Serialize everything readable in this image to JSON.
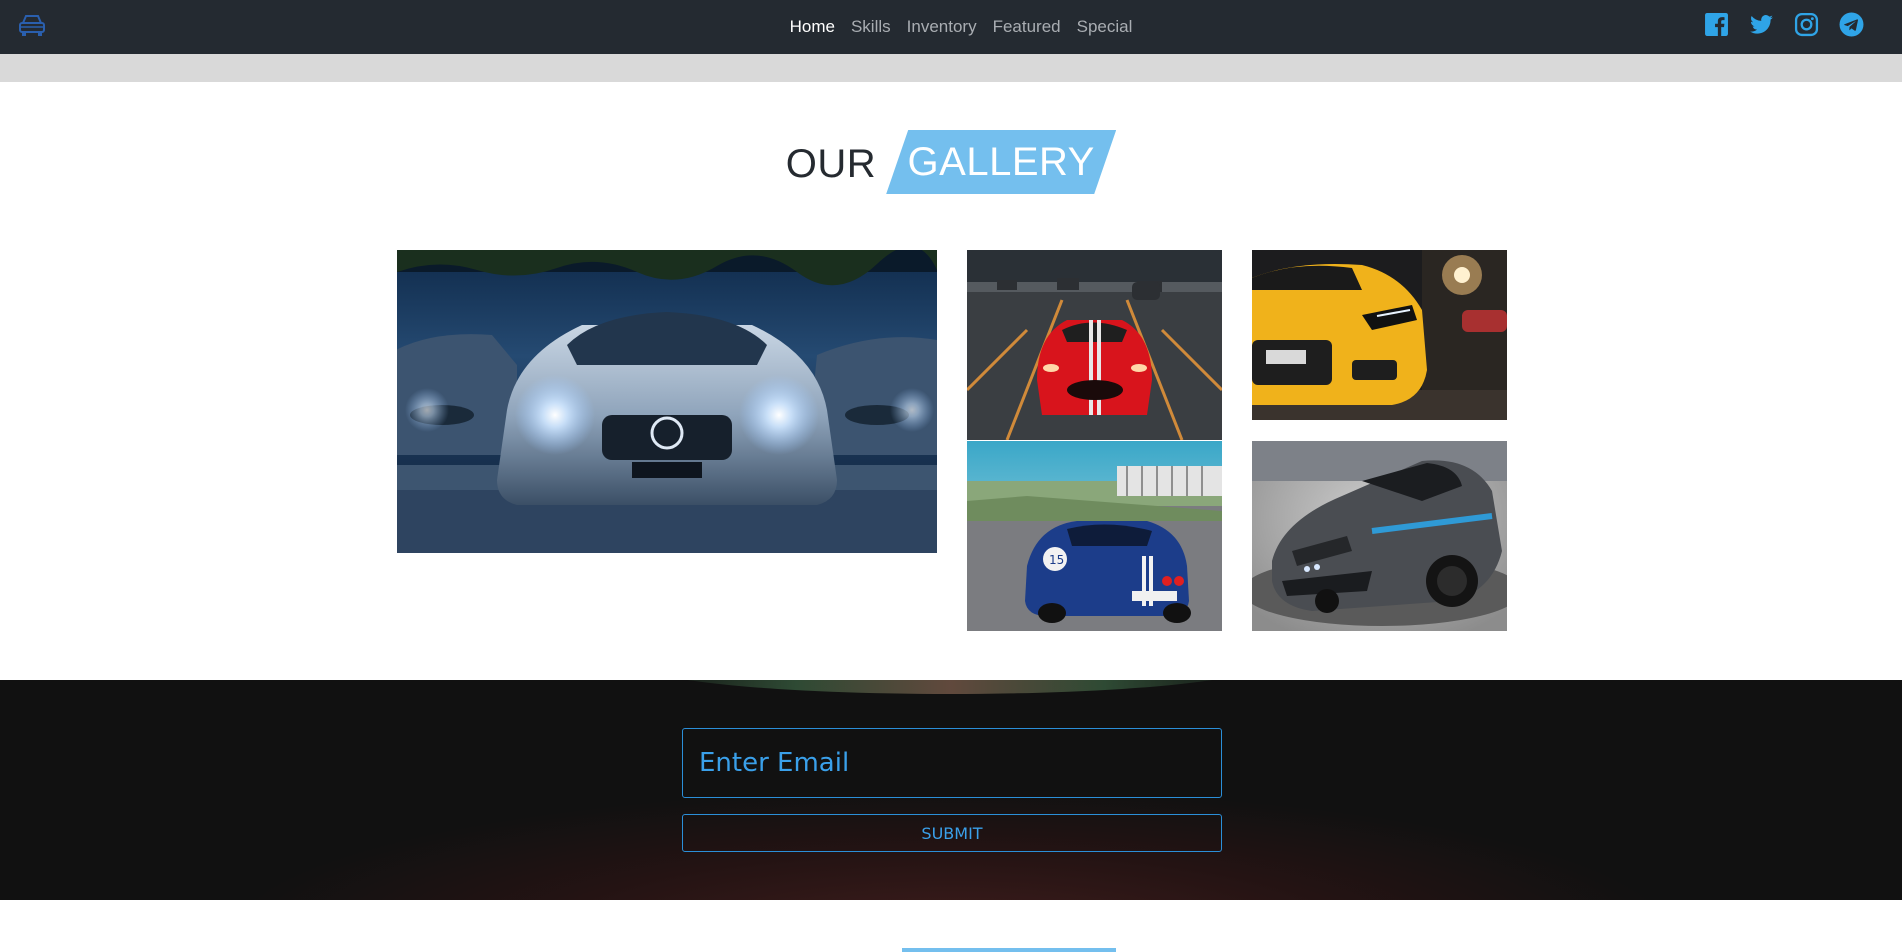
{
  "navbar": {
    "brand_icon": "car-icon",
    "links": [
      {
        "label": "Home",
        "active": true
      },
      {
        "label": "Skills",
        "active": false
      },
      {
        "label": "Inventory",
        "active": false
      },
      {
        "label": "Featured",
        "active": false
      },
      {
        "label": "Special",
        "active": false
      }
    ],
    "socials": [
      "facebook-icon",
      "twitter-icon",
      "instagram-icon",
      "telegram-icon"
    ],
    "accent_color": "#2fa4e7"
  },
  "gallery": {
    "heading_first": "OUR",
    "heading_second": "GALLERY",
    "heading_accent": "#74bfee",
    "photos": [
      {
        "name": "silver-mercedes-photo"
      },
      {
        "name": "red-sports-car-photo"
      },
      {
        "name": "blue-race-car-photo"
      },
      {
        "name": "yellow-audi-photo"
      },
      {
        "name": "grey-corvette-photo"
      }
    ]
  },
  "newsletter": {
    "email_placeholder": "Enter Email",
    "submit_label": "SUBMIT",
    "border_color": "#2b8fd8"
  }
}
